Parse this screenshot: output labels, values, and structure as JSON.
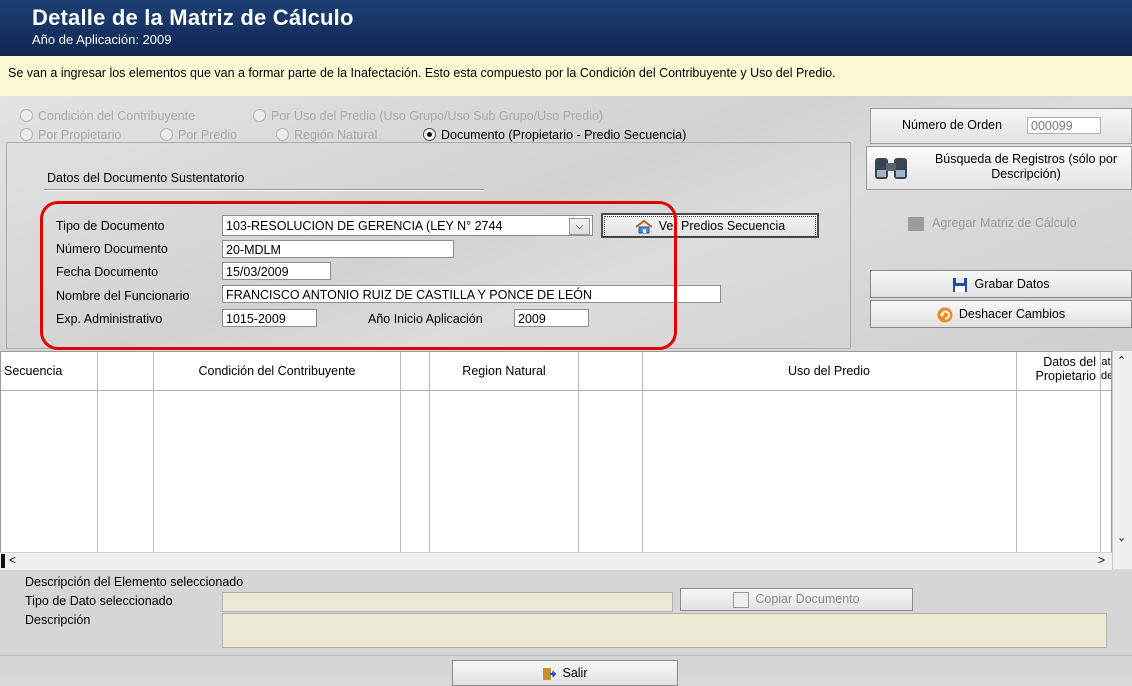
{
  "window": {
    "title": "Detalle de la Matriz de Cálculo",
    "subtitle": "Año de Aplicación: 2009"
  },
  "info_text": "Se van a ingresar los elementos que van a formar parte de la Inafectación. Esto esta compuesto por la Condición del Contribuyente y Uso del Predio.",
  "radios": [
    {
      "label": "Condición del Contribuyente",
      "selected": false,
      "enabled": false
    },
    {
      "label": "Por Uso del Predio (Uso Grupo/Uso Sub Grupo/Uso Predio)",
      "selected": false,
      "enabled": false
    },
    {
      "label": "Por Propietario",
      "selected": false,
      "enabled": false
    },
    {
      "label": "Por Predio",
      "selected": false,
      "enabled": false
    },
    {
      "label": "Región Natural",
      "selected": false,
      "enabled": false
    },
    {
      "label": "Documento (Propietario - Predio Secuencia)",
      "selected": true,
      "enabled": true
    }
  ],
  "documento": {
    "heading": "Datos del Documento Sustentatorio",
    "tipo_label": "Tipo de Documento",
    "tipo_value": "103-RESOLUCION DE GERENCIA (LEY N° 2744",
    "numero_label": "Número Documento",
    "numero_value": "20-MDLM",
    "fecha_label": "Fecha Documento",
    "fecha_value": "15/03/2009",
    "funcionario_label": "Nombre del Funcionario",
    "funcionario_value": "FRANCISCO ANTONIO RUIZ DE CASTILLA Y PONCE DE LEÓN",
    "expediente_label": "Exp. Administrativo",
    "expediente_value": "1015-2009",
    "anio_label": "Año Inicio Aplicación",
    "anio_value": "2009",
    "ver_predios_label": "Ver Predios Secuencia"
  },
  "right_panel": {
    "orden_label": "Número de Orden",
    "orden_value": "000099",
    "busqueda_label": "Búsqueda de Registros (sólo por Descripción)",
    "agregar_label": "Agregar Matriz de Cálculo",
    "grabar_label": "Grabar Datos",
    "deshacer_label": "Deshacer Cambios"
  },
  "grid": {
    "columns": [
      "Secuencia",
      "Condición del Contribuyente",
      "Region Natural",
      "Uso del Predio",
      "Datos del Propietario",
      "at de"
    ],
    "rows": []
  },
  "bottom": {
    "descripcion_elemento_label": "Descripción del Elemento seleccionado",
    "tipo_dato_label": "Tipo de Dato seleccionado",
    "descripcion_label": "Descripción",
    "copiar_label": "Copiar Documento",
    "salir_label": "Salir"
  },
  "colors": {
    "header_bg": "#1e3f74",
    "info_bg": "#fdfbd6",
    "highlight": "#e30000"
  }
}
